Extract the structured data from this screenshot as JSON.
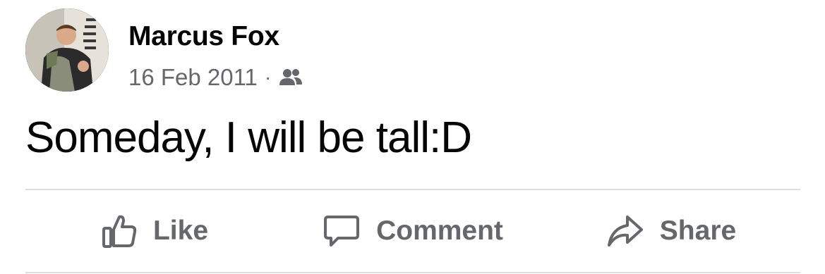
{
  "post": {
    "author": {
      "name": "Marcus Fox",
      "avatar_icon": "profile-photo"
    },
    "date": "16 Feb 2011",
    "separator": "·",
    "audience_icon": "friends-icon",
    "text": "Someday, I will be tall:D"
  },
  "actions": {
    "like_label": "Like",
    "comment_label": "Comment",
    "share_label": "Share"
  },
  "colors": {
    "primary_text": "#050505",
    "secondary_text": "#65676b",
    "divider": "#dedede"
  }
}
